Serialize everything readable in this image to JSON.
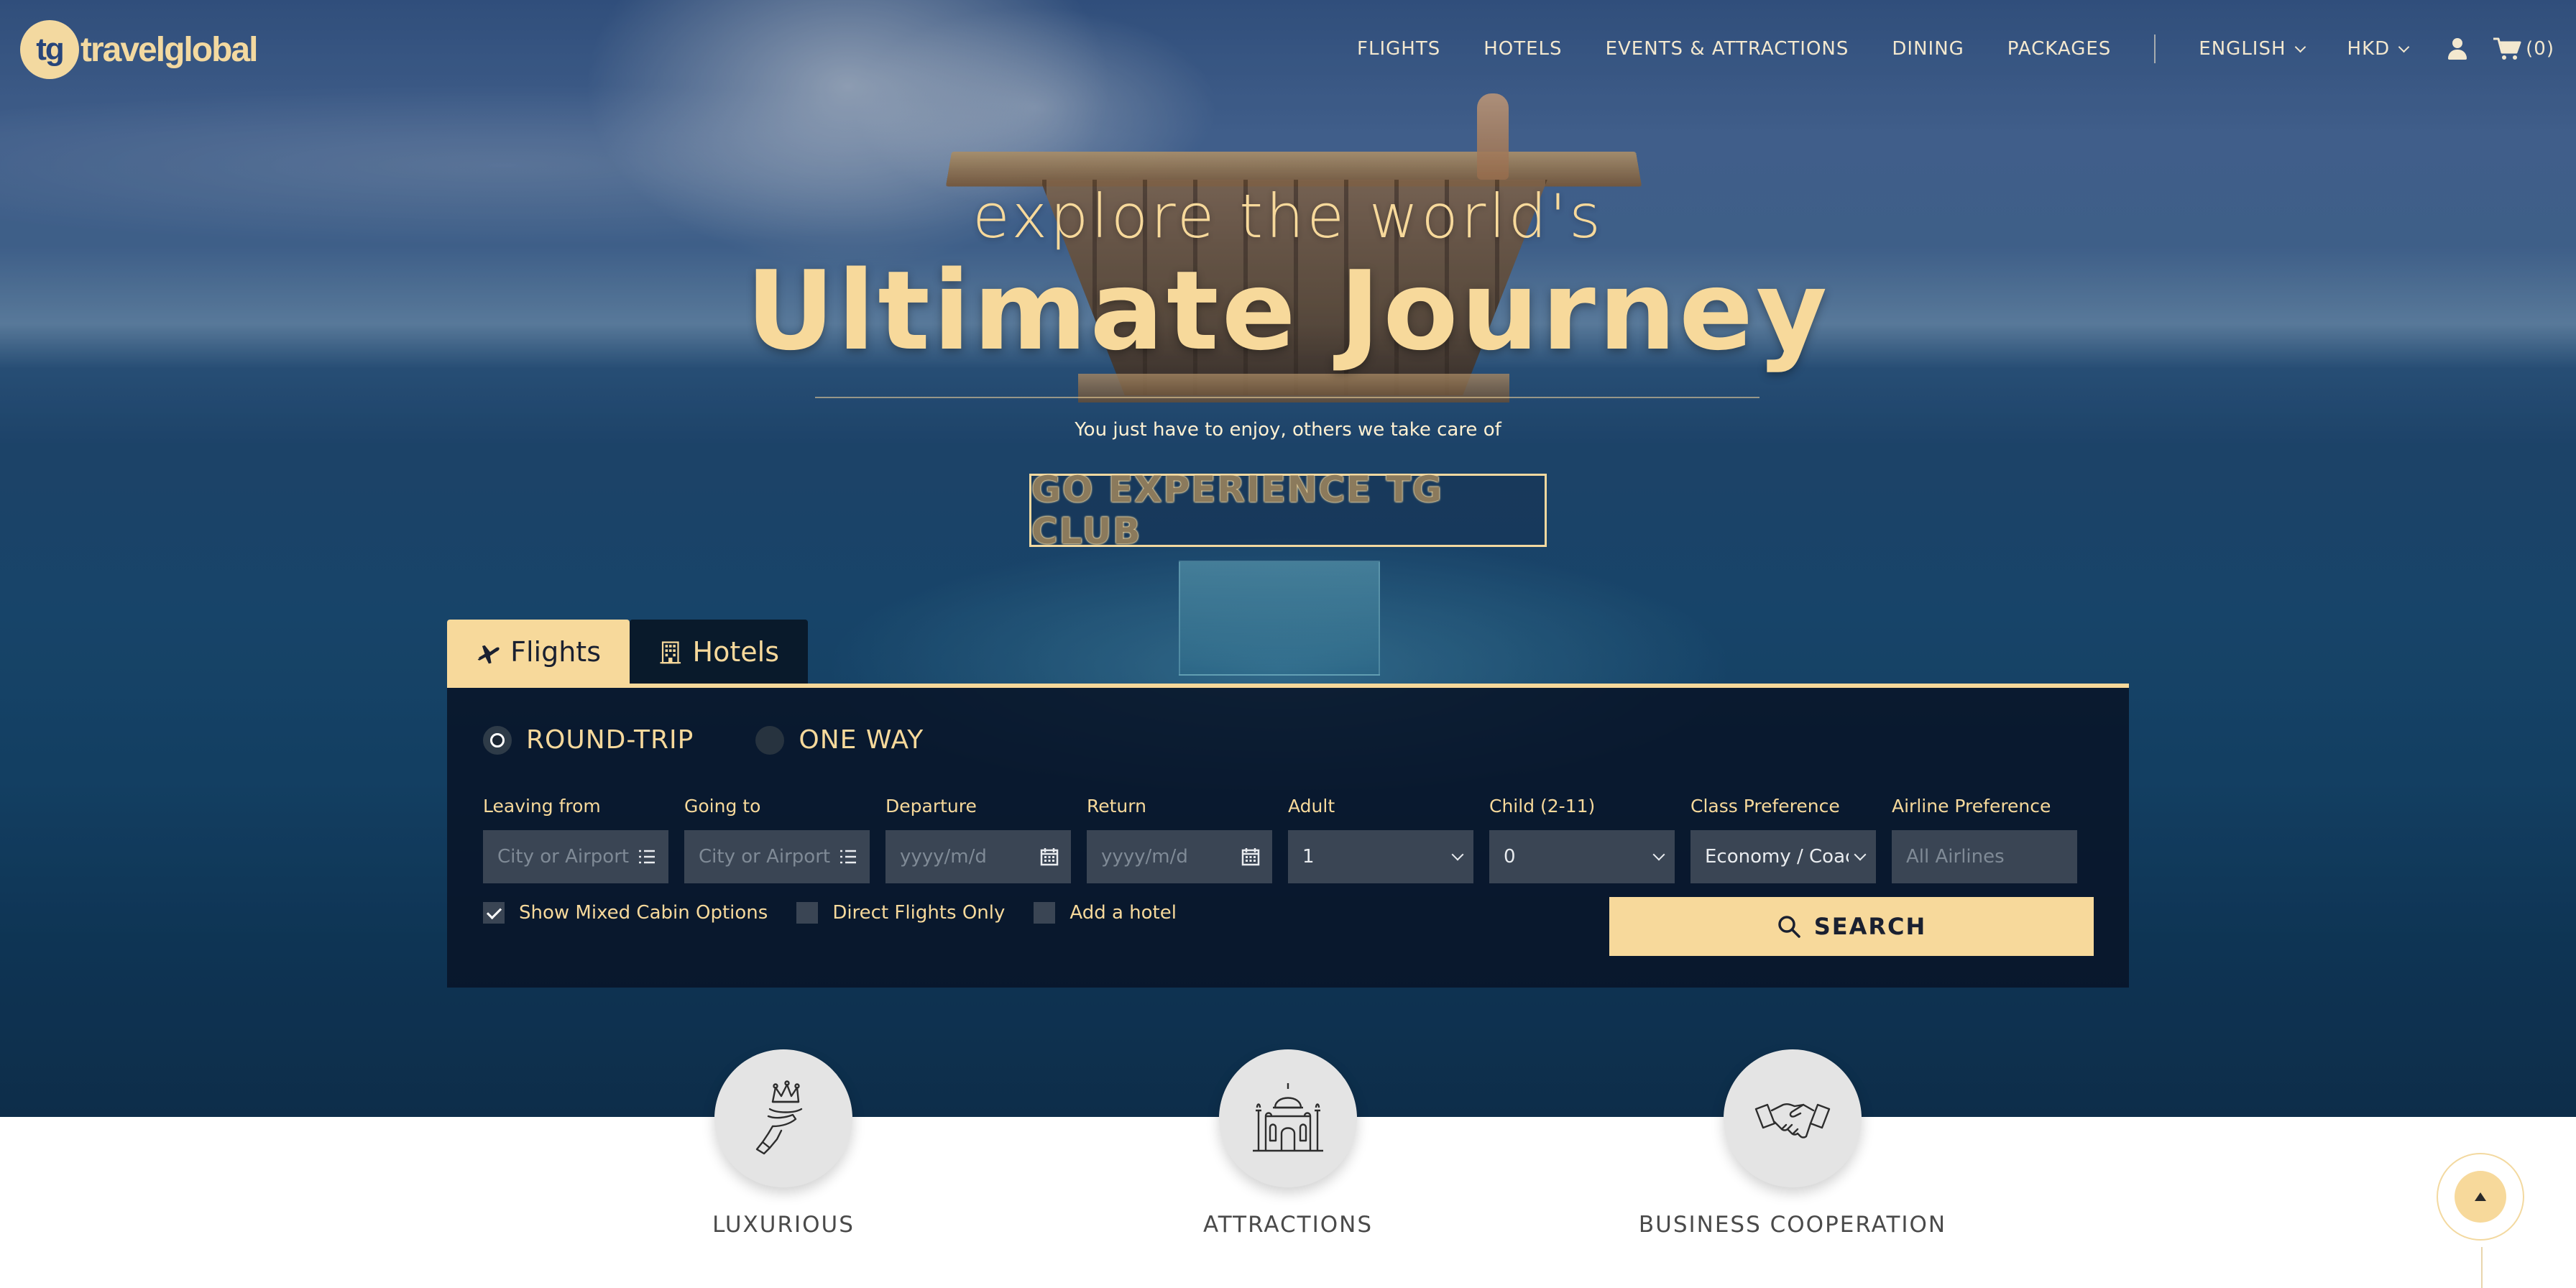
{
  "brand": {
    "logo_mark": "tg",
    "logo_text": "travelglobal"
  },
  "nav": {
    "items": [
      "FLIGHTS",
      "HOTELS",
      "EVENTS & ATTRACTIONS",
      "DINING",
      "PACKAGES"
    ],
    "language": "ENGLISH",
    "currency": "HKD",
    "cart_count": "(0)"
  },
  "hero": {
    "line1": "explore the world's",
    "line2": "Ultimate Journey",
    "subtitle": "You just have to enjoy, others we take care of",
    "cta": "GO EXPERIENCE TG CLUB"
  },
  "search": {
    "tabs": {
      "flights": "Flights",
      "hotels": "Hotels"
    },
    "trip_types": {
      "round_trip": "ROUND-TRIP",
      "one_way": "ONE WAY",
      "selected": "ROUND-TRIP"
    },
    "fields": {
      "leaving_from": {
        "label": "Leaving from",
        "placeholder": "City or Airport"
      },
      "going_to": {
        "label": "Going to",
        "placeholder": "City or Airport"
      },
      "departure": {
        "label": "Departure",
        "placeholder": "yyyy/m/d"
      },
      "return": {
        "label": "Return",
        "placeholder": "yyyy/m/d"
      },
      "adult": {
        "label": "Adult",
        "value": "1"
      },
      "child": {
        "label": "Child (2-11)",
        "value": "0"
      },
      "class_pref": {
        "label": "Class Preference",
        "value": "Economy / Coach"
      },
      "airline_pref": {
        "label": "Airline Preference",
        "placeholder": "All Airlines"
      }
    },
    "options": {
      "mixed_cabin": {
        "label": "Show Mixed Cabin Options",
        "checked": true
      },
      "direct_only": {
        "label": "Direct Flights Only",
        "checked": false
      },
      "add_hotel": {
        "label": "Add a hotel",
        "checked": false
      }
    },
    "search_button": "SEARCH"
  },
  "features": [
    {
      "title": "LUXURIOUS",
      "icon": "crown-hand-icon"
    },
    {
      "title": "ATTRACTIONS",
      "icon": "taj-mahal-icon"
    },
    {
      "title": "BUSINESS COOPERATION",
      "icon": "handshake-icon"
    }
  ],
  "colors": {
    "accent": "#f7d99b",
    "panel": "#08142a",
    "field": "#3a4554"
  }
}
